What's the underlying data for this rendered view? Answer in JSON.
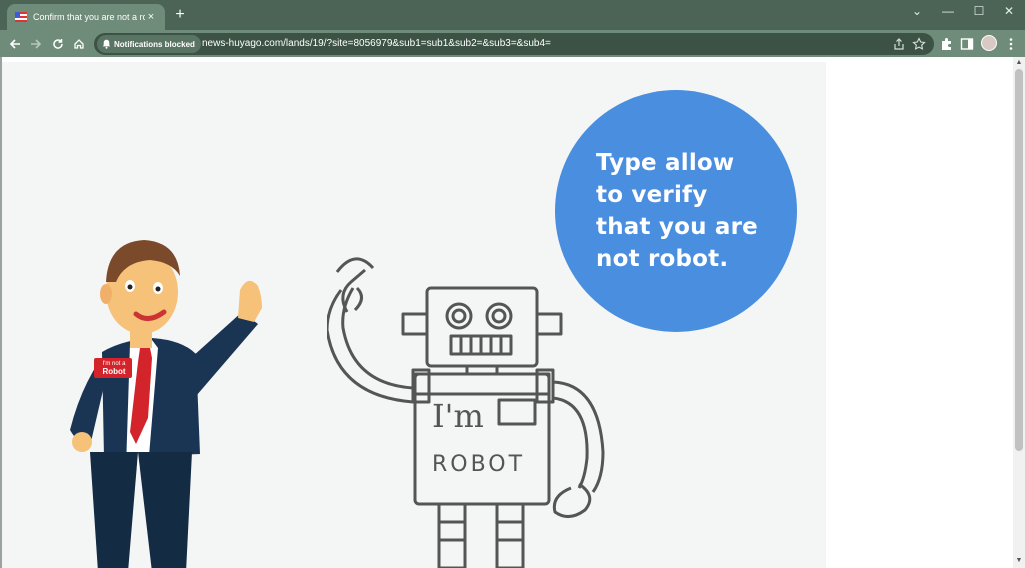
{
  "browser": {
    "tab": {
      "title": "Confirm that you are not a robot",
      "close_glyph": "×"
    },
    "new_tab_glyph": "+",
    "window_controls": {
      "dropdown": "⌄",
      "minimize": "—",
      "maximize": "☐",
      "close": "✕"
    },
    "notification_chip": "Notifications blocked",
    "url": "news-huyago.com/lands/19/?site=8056979&sub1=sub1&sub2=&sub3=&sub4="
  },
  "page": {
    "message": "Type allow to verify that you are not robot.",
    "badge_line1": "I'm not a",
    "badge_line2": "Robot",
    "robot_chest_line1": "I'm",
    "robot_chest_line2": "ROBOT"
  },
  "colors": {
    "titlebar": "#4b6455",
    "toolbar": "#6f8b79",
    "bubble": "#4a8ee0",
    "stage_bg": "#f4f5f5"
  }
}
